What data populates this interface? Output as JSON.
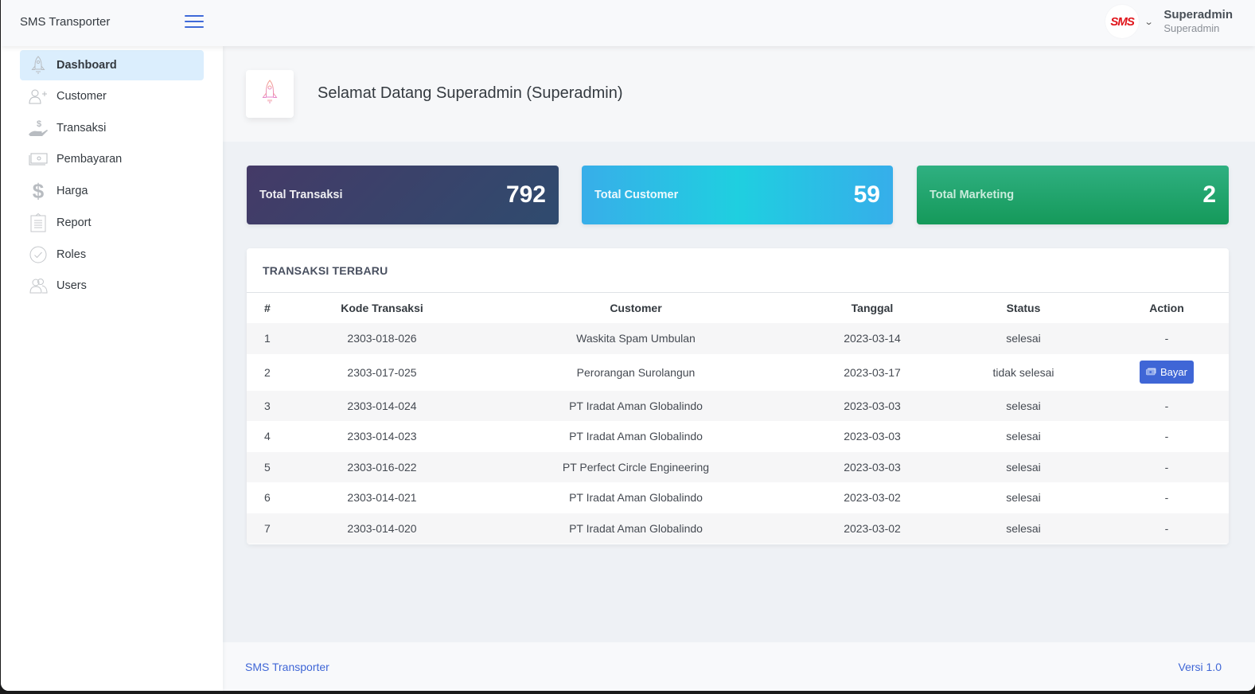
{
  "header": {
    "brand": "SMS Transporter",
    "avatar_logo": "SMS",
    "user_name": "Superadmin",
    "user_role": "Superadmin"
  },
  "sidebar": {
    "items": [
      {
        "label": "Dashboard",
        "icon": "rocket-icon",
        "active": true
      },
      {
        "label": "Customer",
        "icon": "user-plus-icon"
      },
      {
        "label": "Transaksi",
        "icon": "hand-dollar-icon"
      },
      {
        "label": "Pembayaran",
        "icon": "cash-icon"
      },
      {
        "label": "Harga",
        "icon": "dollar-icon"
      },
      {
        "label": "Report",
        "icon": "clipboard-icon"
      },
      {
        "label": "Roles",
        "icon": "check-circle-icon"
      },
      {
        "label": "Users",
        "icon": "users-icon"
      }
    ]
  },
  "page": {
    "title": "Selamat Datang Superadmin (Superadmin)"
  },
  "stats": [
    {
      "label": "Total Transaksi",
      "value": "792"
    },
    {
      "label": "Total Customer",
      "value": "59"
    },
    {
      "label": "Total Marketing",
      "value": "2"
    }
  ],
  "transactions": {
    "title": "TRANSAKSI TERBARU",
    "columns": [
      "#",
      "Kode Transaksi",
      "Customer",
      "Tanggal",
      "Status",
      "Action"
    ],
    "rows": [
      {
        "no": "1",
        "kode": "2303-018-026",
        "customer": "Waskita Spam Umbulan",
        "tanggal": "2023-03-14",
        "status": "selesai",
        "action": "-"
      },
      {
        "no": "2",
        "kode": "2303-017-025",
        "customer": "Perorangan Surolangun",
        "tanggal": "2023-03-17",
        "status": "tidak selesai",
        "action": "Bayar"
      },
      {
        "no": "3",
        "kode": "2303-014-024",
        "customer": "PT Iradat Aman Globalindo",
        "tanggal": "2023-03-03",
        "status": "selesai",
        "action": "-"
      },
      {
        "no": "4",
        "kode": "2303-014-023",
        "customer": "PT Iradat Aman Globalindo",
        "tanggal": "2023-03-03",
        "status": "selesai",
        "action": "-"
      },
      {
        "no": "5",
        "kode": "2303-016-022",
        "customer": "PT Perfect Circle Engineering",
        "tanggal": "2023-03-03",
        "status": "selesai",
        "action": "-"
      },
      {
        "no": "6",
        "kode": "2303-014-021",
        "customer": "PT Iradat Aman Globalindo",
        "tanggal": "2023-03-02",
        "status": "selesai",
        "action": "-"
      },
      {
        "no": "7",
        "kode": "2303-014-020",
        "customer": "PT Iradat Aman Globalindo",
        "tanggal": "2023-03-02",
        "status": "selesai",
        "action": "-"
      }
    ]
  },
  "footer": {
    "left": "SMS Transporter",
    "right": "Versi 1.0"
  },
  "colors": {
    "accent": "#3f66d6",
    "active_nav_bg": "#dbeefd",
    "card_transaksi": "#3b4269",
    "card_customer": "#22c6e3",
    "card_marketing": "#1fa56b",
    "logo_red": "#e0151b"
  }
}
